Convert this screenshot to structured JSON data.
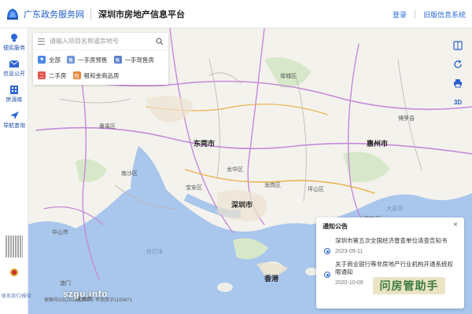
{
  "header": {
    "site_name": "广东政务服务网",
    "platform_name": "深圳市房地产信息平台",
    "login": "登录",
    "old_version": "旧版信息系统"
  },
  "sidebar": {
    "items": [
      {
        "label": "便民服务",
        "icon": "bulb-icon"
      },
      {
        "label": "信息公开",
        "icon": "mail-icon"
      },
      {
        "label": "房源库",
        "icon": "building-icon"
      },
      {
        "label": "导航查询",
        "icon": "nav-arrow-icon"
      }
    ],
    "footer": "联系我们/报错"
  },
  "search": {
    "placeholder": "请输入项目名称或宗地号",
    "filters": [
      {
        "label": "全部",
        "color": "#4a86e8",
        "glyph": "■"
      },
      {
        "label": "一手房预售",
        "color": "#6f95d8",
        "glyph": "售"
      },
      {
        "label": "一手现售房",
        "color": "#5d7fd0",
        "glyph": "售"
      },
      {
        "label": "二手房",
        "color": "#e0574d",
        "glyph": "二"
      },
      {
        "label": "租和金商品房",
        "color": "#e8873a",
        "glyph": "租"
      }
    ]
  },
  "tools": {
    "threed": "3D",
    "items": [
      "map-book-icon",
      "refresh-icon",
      "printer-icon"
    ]
  },
  "map": {
    "labels": [
      {
        "text": "增城区",
        "kind": "place"
      },
      {
        "text": "东莞市",
        "kind": "city"
      },
      {
        "text": "深圳市",
        "kind": "city"
      },
      {
        "text": "惠州市",
        "kind": "city"
      },
      {
        "text": "中山市",
        "kind": "place"
      },
      {
        "text": "珠海市",
        "kind": "place"
      },
      {
        "text": "香港",
        "kind": "city"
      },
      {
        "text": "龙华区",
        "kind": "place"
      },
      {
        "text": "龙岗区",
        "kind": "place"
      },
      {
        "text": "坪山区",
        "kind": "place"
      },
      {
        "text": "大鹏新区",
        "kind": "place"
      },
      {
        "text": "宝安区",
        "kind": "place"
      },
      {
        "text": "博罗县",
        "kind": "place"
      },
      {
        "text": "南沙区",
        "kind": "place"
      },
      {
        "text": "番禺区",
        "kind": "place"
      },
      {
        "text": "伶仃洋",
        "kind": "sea"
      },
      {
        "text": "大亚湾",
        "kind": "sea"
      },
      {
        "text": "澳门",
        "kind": "place"
      }
    ],
    "copyright": "审图号GS(2022)1248号 甲测资字1100471"
  },
  "notice": {
    "title": "通知公告",
    "close": "×",
    "items": [
      {
        "text": "深圳市第五次全国经济普查单位清查告知书",
        "date": "2023-09-11"
      },
      {
        "text": "关于商业银行等非房地产行业机构开通系统权限通知",
        "date": "2020-10-09"
      }
    ]
  },
  "watermark": {
    "left": "szgu.info",
    "right": "问房管助手"
  }
}
